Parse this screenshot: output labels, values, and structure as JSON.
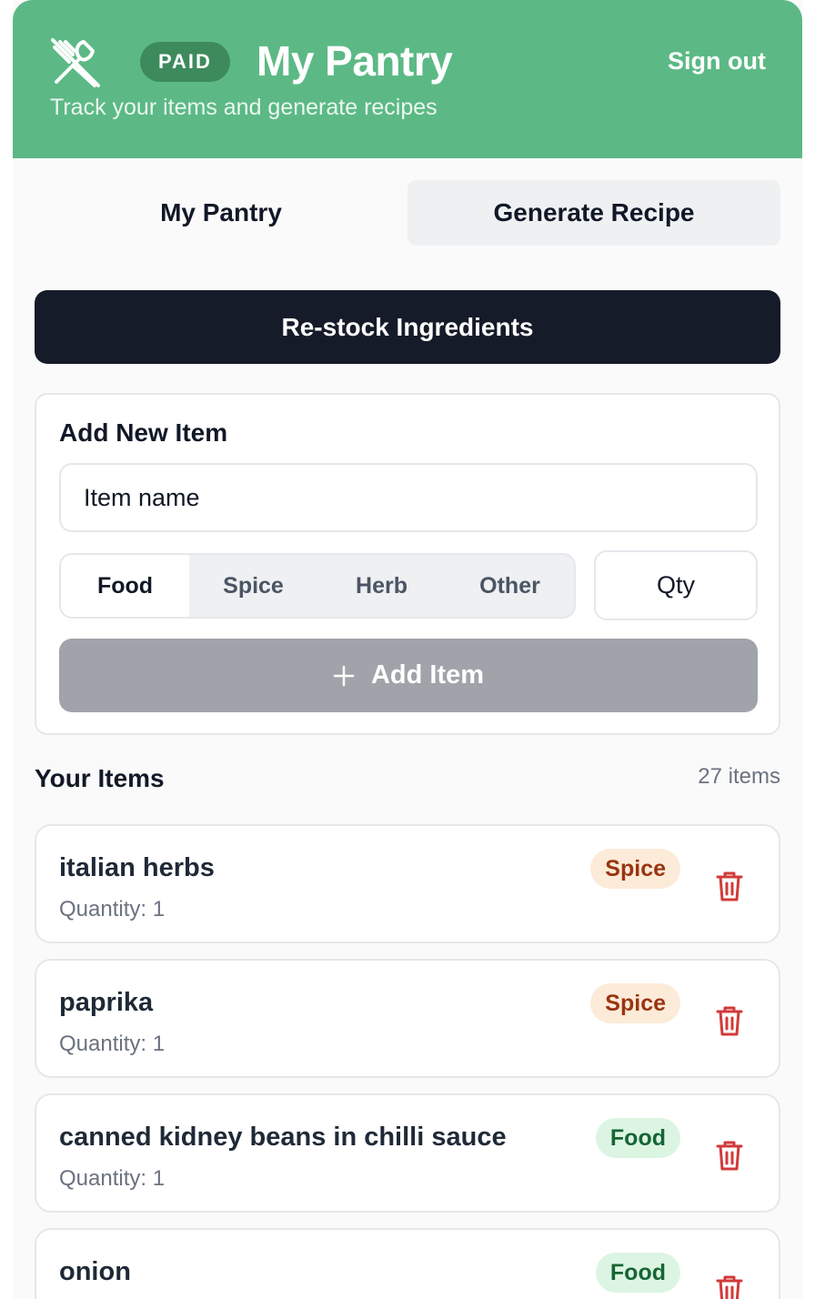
{
  "header": {
    "badge": "PAID",
    "title": "My Pantry",
    "subtitle": "Track your items and generate recipes",
    "sign_out": "Sign out",
    "logo_icon": "fork-knife-crossed-icon"
  },
  "tabs": [
    {
      "label": "My Pantry",
      "active": true
    },
    {
      "label": "Generate Recipe",
      "active": false
    }
  ],
  "restock_button": "Re-stock Ingredients",
  "add_form": {
    "title": "Add New Item",
    "name_placeholder": "Item name",
    "categories": [
      "Food",
      "Spice",
      "Herb",
      "Other"
    ],
    "selected_category": "Food",
    "qty_placeholder": "Qty",
    "add_button": "Add Item"
  },
  "items_section": {
    "title": "Your Items",
    "count": "27 items"
  },
  "items": [
    {
      "name": "italian herbs",
      "quantity": "Quantity: 1",
      "category": "Spice"
    },
    {
      "name": "paprika",
      "quantity": "Quantity: 1",
      "category": "Spice"
    },
    {
      "name": "canned kidney beans in chilli sauce",
      "quantity": "Quantity: 1",
      "category": "Food"
    },
    {
      "name": "onion",
      "quantity": "",
      "category": "Food"
    }
  ],
  "colors": {
    "header_bg": "#5cb985",
    "badge_bg": "#3d8a5d",
    "restock_bg": "#151b28",
    "spice_tag_bg": "#fcebd8",
    "spice_tag_text": "#9a3412",
    "food_tag_bg": "#dcf5e3",
    "food_tag_text": "#166534",
    "trash_color": "#d23a3a"
  }
}
